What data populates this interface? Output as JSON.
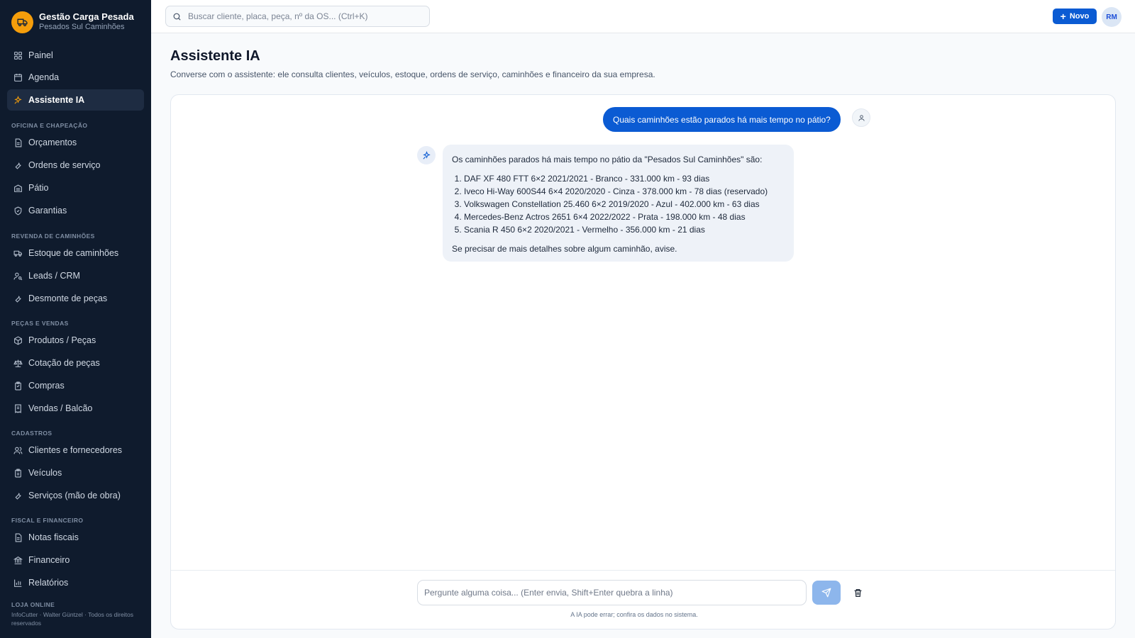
{
  "brand": {
    "title": "Gestão Carga Pesada",
    "subtitle": "Pesados Sul Caminhões"
  },
  "sidebar": {
    "top_items": [
      {
        "label": "Painel",
        "icon": "grid-icon"
      },
      {
        "label": "Agenda",
        "icon": "calendar-icon"
      },
      {
        "label": "Assistente IA",
        "icon": "sparkle-icon",
        "active": true
      }
    ],
    "sections": [
      {
        "label": "OFICINA E CHAPEAÇÃO",
        "items": [
          "Orçamentos",
          "Ordens de serviço",
          "Pátio",
          "Garantias"
        ]
      },
      {
        "label": "REVENDA DE CAMINHÕES",
        "items": [
          "Estoque de caminhões",
          "Leads / CRM",
          "Desmonte de peças"
        ]
      },
      {
        "label": "PEÇAS E VENDAS",
        "items": [
          "Produtos / Peças",
          "Cotação de peças",
          "Compras",
          "Vendas / Balcão"
        ]
      },
      {
        "label": "CADASTROS",
        "items": [
          "Clientes e fornecedores",
          "Veículos",
          "Serviços (mão de obra)"
        ]
      },
      {
        "label": "FISCAL E FINANCEIRO",
        "items": [
          "Notas fiscais",
          "Financeiro",
          "Relatórios"
        ]
      },
      {
        "label": "LOJA ONLINE",
        "items": []
      }
    ],
    "footer": "InfoCutter · Walter Güntzel · Todos os direitos reservados"
  },
  "topbar": {
    "search_placeholder": "Buscar cliente, placa, peça, nº da OS...  (Ctrl+K)",
    "new_label": "Novo",
    "user_initials": "RM"
  },
  "page": {
    "title": "Assistente IA",
    "description": "Converse com o assistente: ele consulta clientes, veículos, estoque, ordens de serviço, caminhões e financeiro da sua empresa."
  },
  "chat": {
    "user_message": "Quais caminhões estão parados há mais tempo no pátio?",
    "ai_intro": "Os caminhões parados há mais tempo no pátio da \"Pesados Sul Caminhões\" são:",
    "ai_list": [
      "DAF XF 480 FTT 6×2 2021/2021 - Branco - 331.000 km - 93 dias",
      "Iveco Hi-Way 600S44 6×4 2020/2020 - Cinza - 378.000 km - 78 dias (reservado)",
      "Volkswagen Constellation 25.460 6×2 2019/2020 - Azul - 402.000 km - 63 dias",
      "Mercedes-Benz Actros 2651 6×4 2022/2022 - Prata - 198.000 km - 48 dias",
      "Scania R 450 6×2 2020/2021 - Vermelho - 356.000 km - 21 dias"
    ],
    "ai_outro": "Se precisar de mais detalhes sobre algum caminhão, avise.",
    "input_placeholder": "Pergunte alguma coisa... (Enter envia, Shift+Enter quebra a linha)",
    "disclaimer": "A IA pode errar; confira os dados no sistema."
  },
  "colors": {
    "sidebar_bg": "#0f1b2d",
    "accent": "#0b5bd3",
    "brand_logo": "#f59e0b",
    "ai_bubble": "#eef2f8"
  }
}
